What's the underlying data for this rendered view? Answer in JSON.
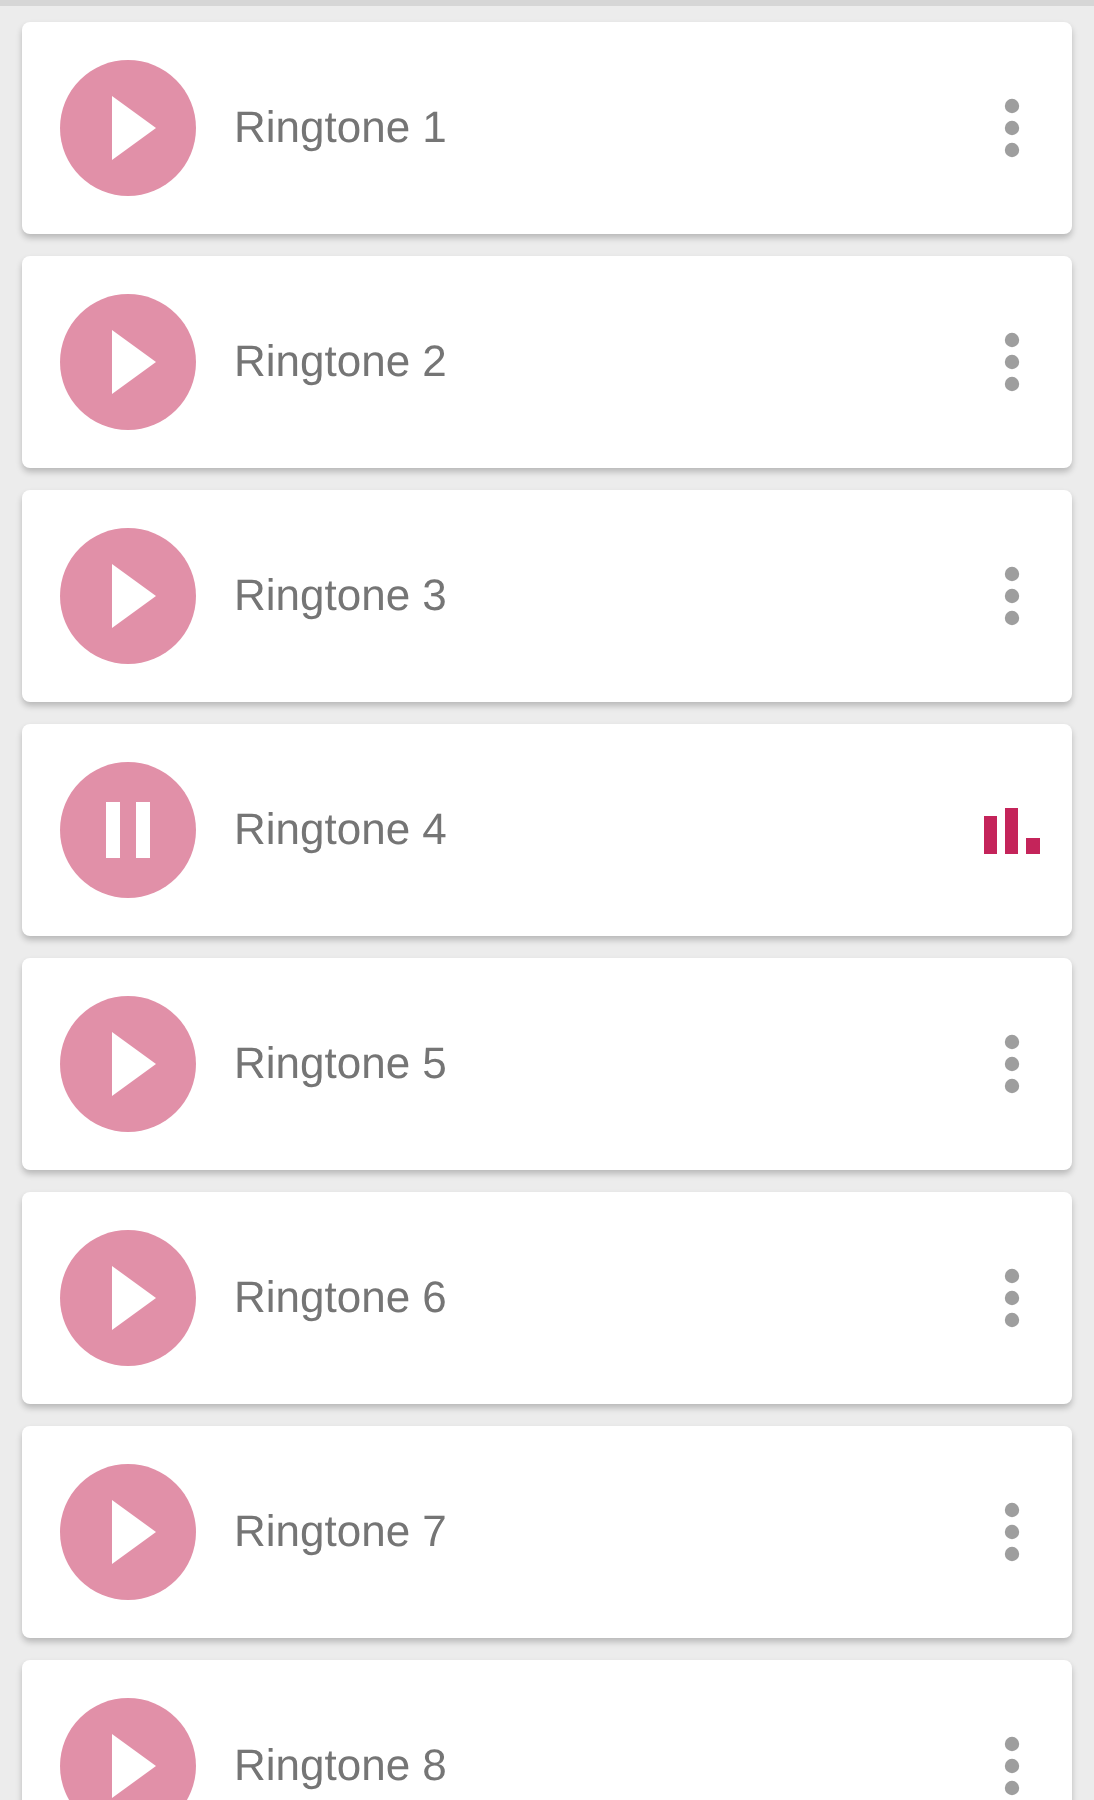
{
  "ringtones": [
    {
      "name": "Ringtone 1",
      "playing": false
    },
    {
      "name": "Ringtone 2",
      "playing": false
    },
    {
      "name": "Ringtone 3",
      "playing": false
    },
    {
      "name": "Ringtone 4",
      "playing": true
    },
    {
      "name": "Ringtone 5",
      "playing": false
    },
    {
      "name": "Ringtone 6",
      "playing": false
    },
    {
      "name": "Ringtone 7",
      "playing": false
    },
    {
      "name": "Ringtone 8",
      "playing": false
    }
  ]
}
